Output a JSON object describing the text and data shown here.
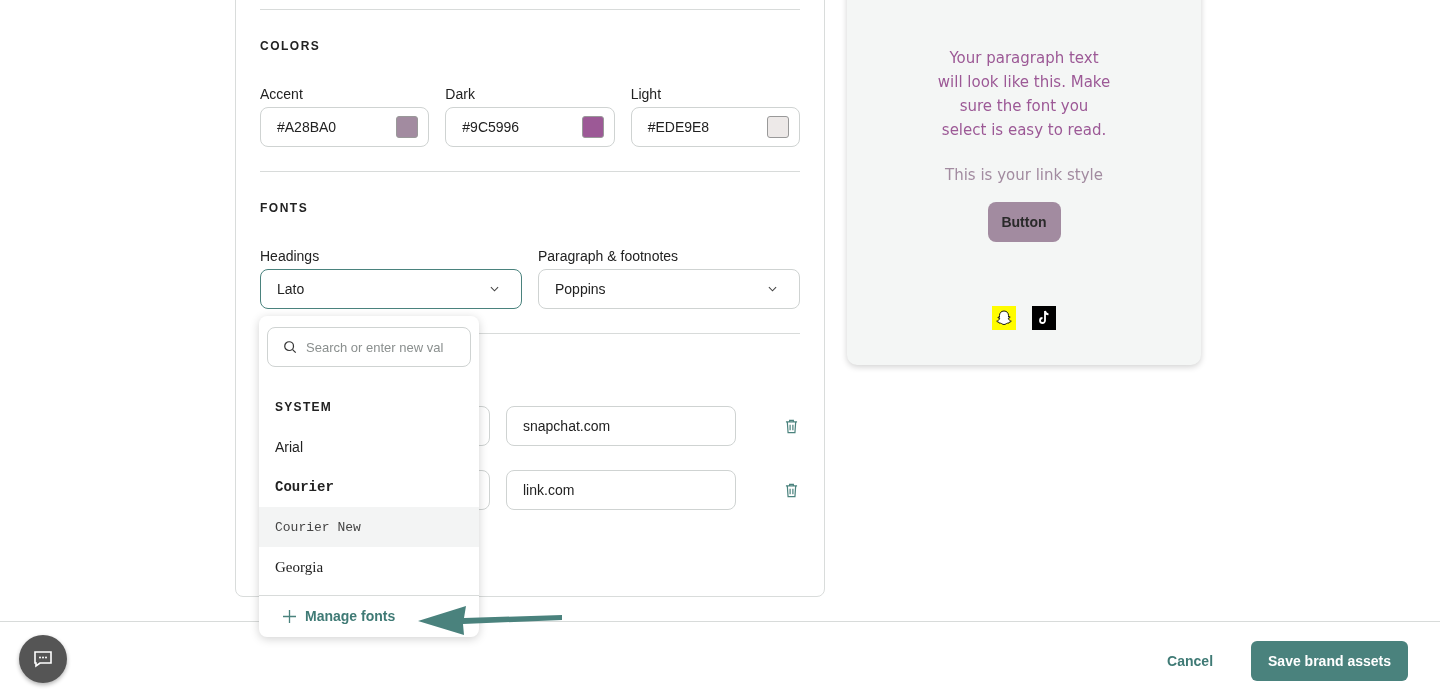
{
  "colors": {
    "heading": "COLORS",
    "swatches": [
      {
        "label": "Accent",
        "value": "#A28BA0",
        "color": "#a28ba0"
      },
      {
        "label": "Dark",
        "value": "#9C5996",
        "color": "#9c5996"
      },
      {
        "label": "Light",
        "value": "#EDE9E8",
        "color": "#ede9e8"
      }
    ]
  },
  "fonts": {
    "heading": "FONTS",
    "selects": [
      {
        "label": "Headings",
        "value": "Lato",
        "focused": true
      },
      {
        "label": "Paragraph & footnotes",
        "value": "Poppins",
        "focused": false
      }
    ]
  },
  "links": {
    "rows": [
      {
        "url": "snapchat.com"
      },
      {
        "url": "link.com"
      }
    ]
  },
  "dropdown": {
    "search_placeholder": "Search or enter new val",
    "group": "SYSTEM",
    "options": [
      {
        "label": "Arial",
        "kind": "sans",
        "highlighted": false
      },
      {
        "label": "Courier",
        "kind": "mono-bold",
        "highlighted": false
      },
      {
        "label": "Courier New",
        "kind": "mono",
        "highlighted": true
      },
      {
        "label": "Georgia",
        "kind": "serif",
        "highlighted": false
      }
    ],
    "action": "Manage fonts"
  },
  "preview": {
    "paragraph": "Your paragraph text will look like this. Make sure the font you select is easy to read.",
    "link_text": "This is your link style",
    "button_label": "Button"
  },
  "footer": {
    "cancel": "Cancel",
    "save": "Save brand assets"
  }
}
